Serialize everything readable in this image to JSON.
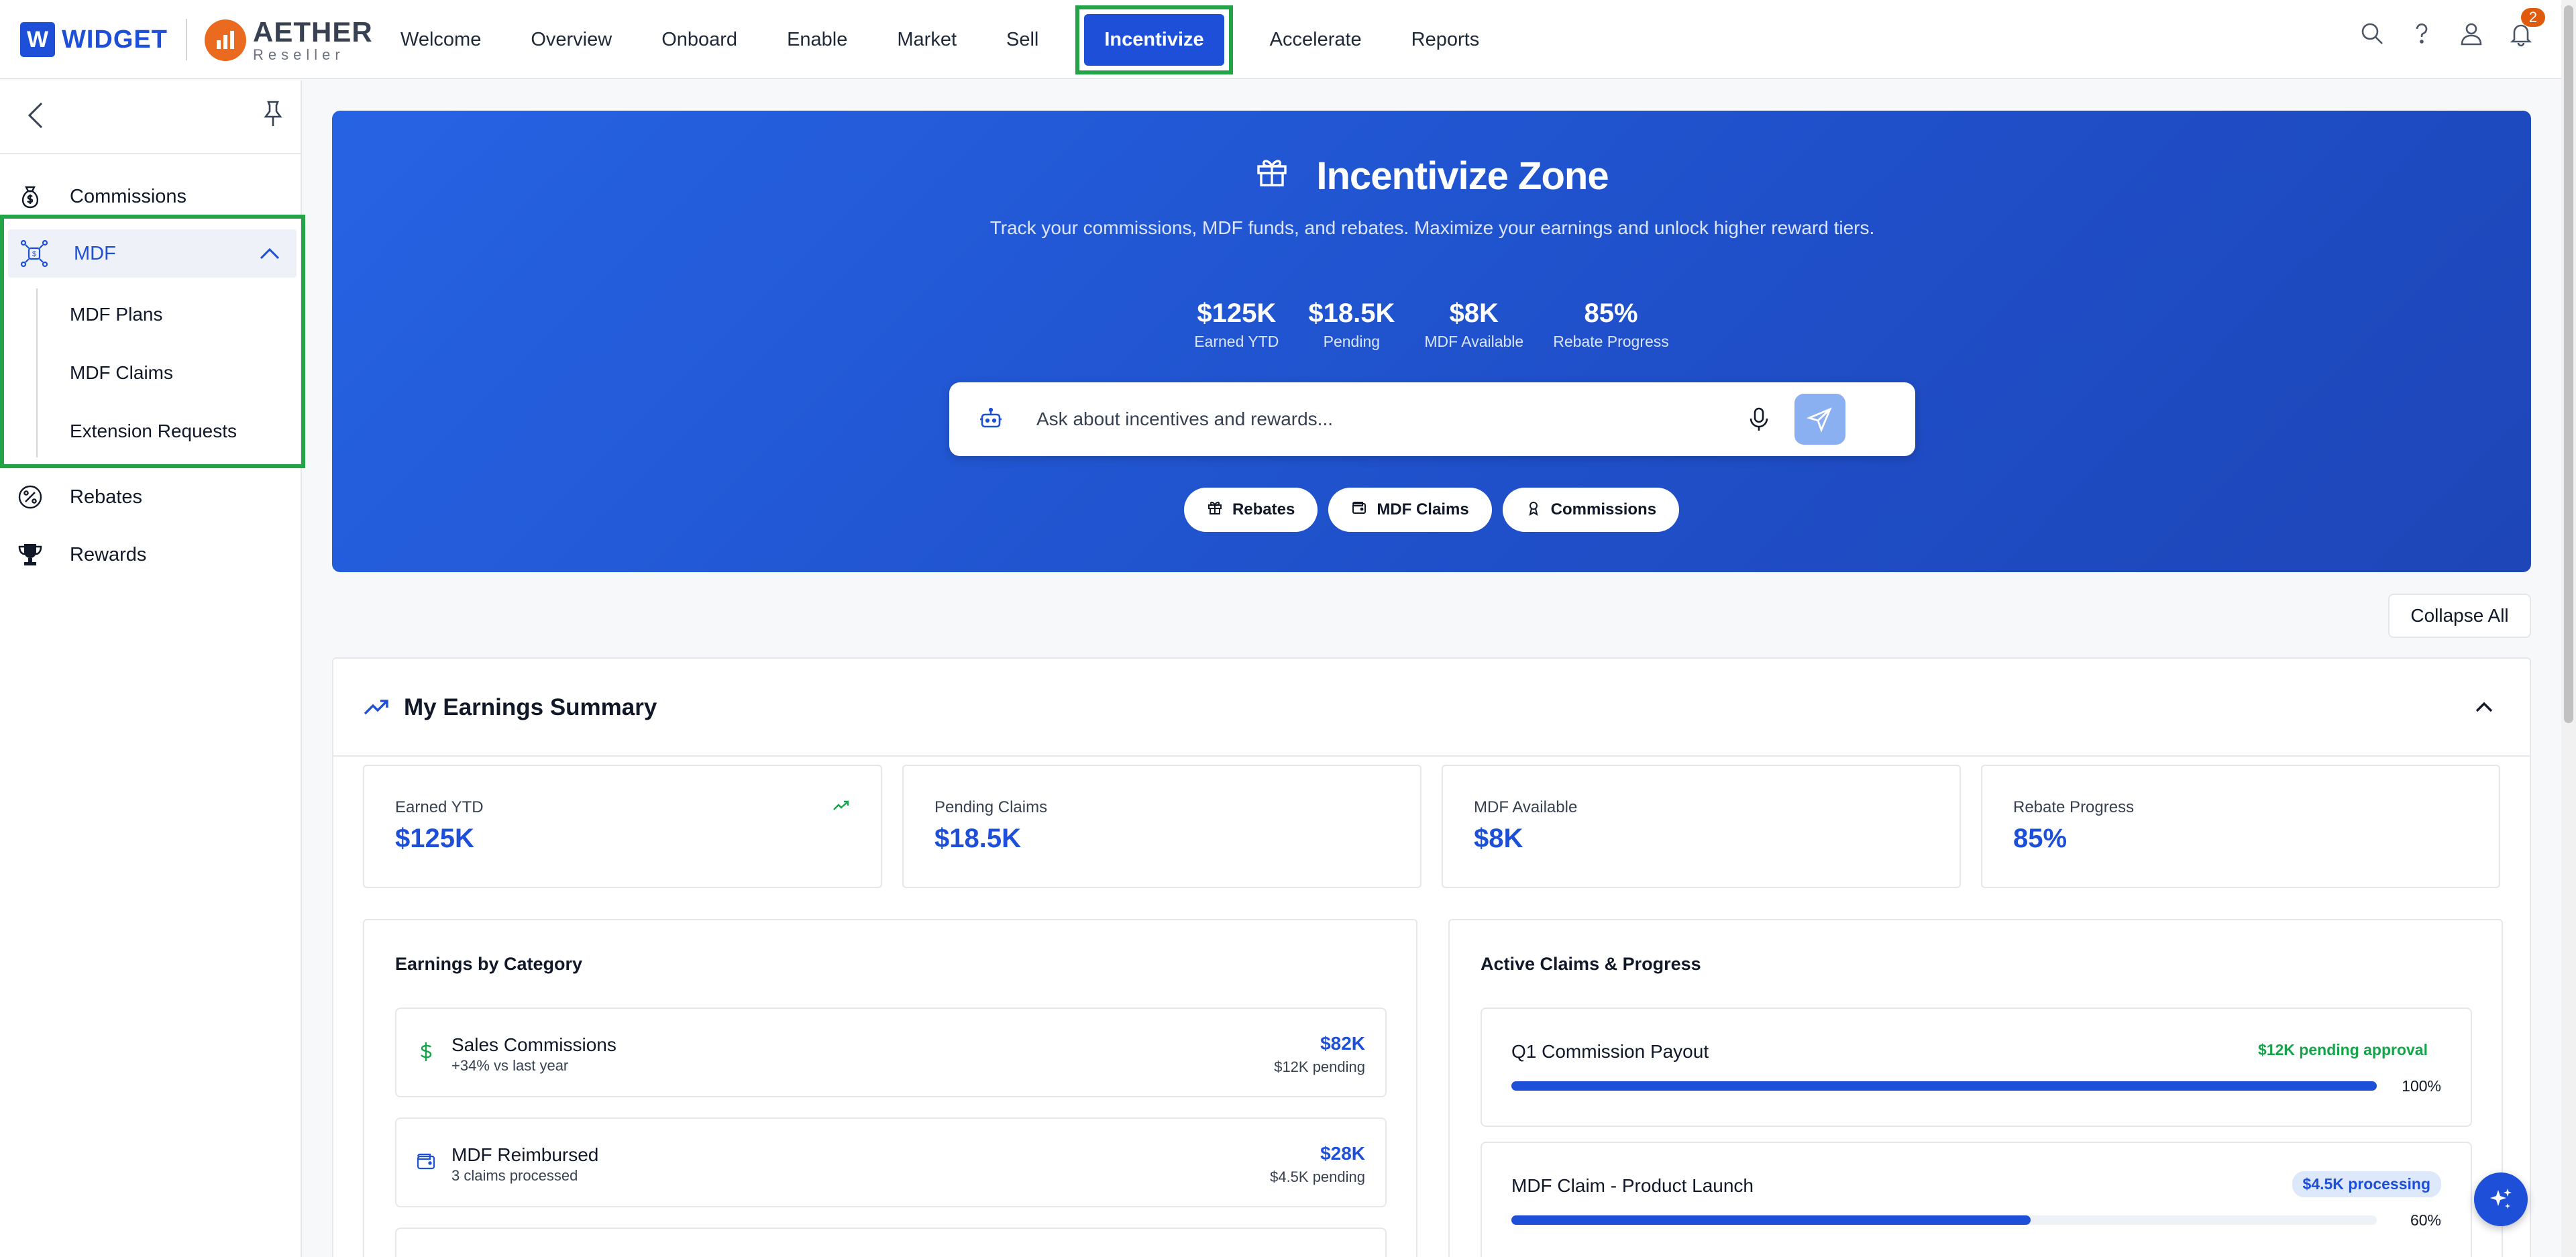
{
  "header": {
    "logo_primary": "WIDGET",
    "logo_primary_letter": "W",
    "logo_secondary": "AETHER",
    "logo_secondary_sub": "Reseller",
    "nav": [
      "Welcome",
      "Overview",
      "Onboard",
      "Enable",
      "Market",
      "Sell",
      "Incentivize",
      "Accelerate",
      "Reports"
    ],
    "active_nav": "Incentivize",
    "notification_count": "2"
  },
  "sidebar": {
    "items": [
      {
        "label": "Commissions",
        "icon": "money-bag-icon"
      },
      {
        "label": "MDF",
        "icon": "network-icon",
        "expanded": true
      },
      {
        "label": "Rebates",
        "icon": "percent-icon"
      },
      {
        "label": "Rewards",
        "icon": "trophy-icon"
      }
    ],
    "mdf_children": [
      "MDF Plans",
      "MDF Claims",
      "Extension Requests"
    ]
  },
  "hero": {
    "title": "Incentivize Zone",
    "description": "Track your commissions, MDF funds, and rebates. Maximize your earnings and unlock higher reward tiers.",
    "stats": [
      {
        "value": "$125K",
        "label": "Earned YTD"
      },
      {
        "value": "$18.5K",
        "label": "Pending"
      },
      {
        "value": "$8K",
        "label": "MDF Available"
      },
      {
        "value": "85%",
        "label": "Rebate Progress"
      }
    ],
    "search_placeholder": "Ask about incentives and rewards...",
    "chips": [
      "Rebates",
      "MDF Claims",
      "Commissions"
    ]
  },
  "collapse_all_label": "Collapse All",
  "earnings": {
    "title": "My Earnings Summary",
    "kpis": [
      {
        "label": "Earned YTD",
        "value": "$125K"
      },
      {
        "label": "Pending Claims",
        "value": "$18.5K"
      },
      {
        "label": "MDF Available",
        "value": "$8K"
      },
      {
        "label": "Rebate Progress",
        "value": "85%"
      }
    ],
    "by_category": {
      "title": "Earnings by Category",
      "rows": [
        {
          "name": "Sales Commissions",
          "sub": "+34% vs last year",
          "amount": "$82K",
          "pending": "$12K pending"
        },
        {
          "name": "MDF Reimbursed",
          "sub": "3 claims processed",
          "amount": "$28K",
          "pending": "$4.5K pending"
        }
      ]
    },
    "active_claims": {
      "title": "Active Claims & Progress",
      "rows": [
        {
          "name": "Q1 Commission Payout",
          "status": "$12K pending approval",
          "progress": 100,
          "progress_label": "100%"
        },
        {
          "name": "MDF Claim - Product Launch",
          "status": "$4.5K processing",
          "progress": 60,
          "progress_label": "60%"
        }
      ]
    }
  },
  "colors": {
    "brand_blue": "#1e4fd8",
    "highlight_green": "#22a447",
    "aether_orange": "#ea6b1f",
    "success_green": "#16a34a"
  }
}
